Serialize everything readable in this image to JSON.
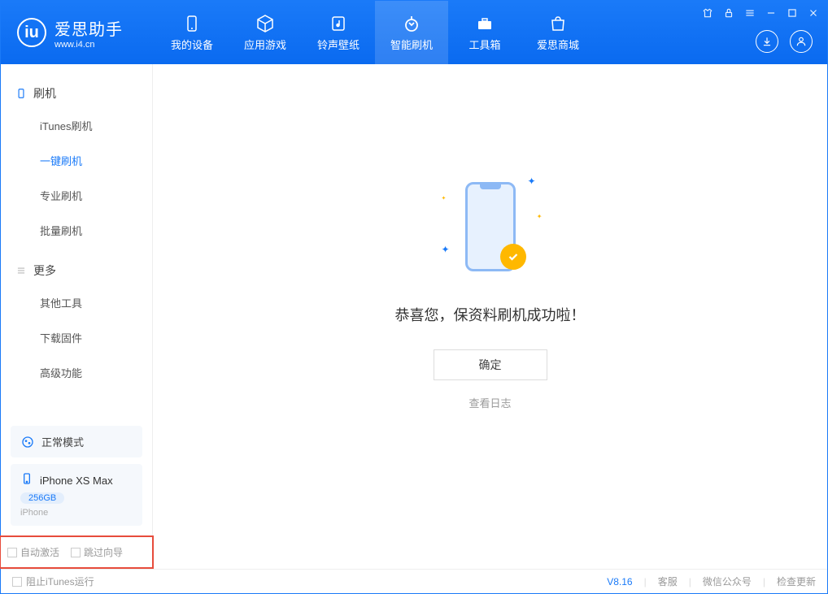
{
  "header": {
    "logo_title": "爱思助手",
    "logo_url": "www.i4.cn",
    "tabs": [
      {
        "label": "我的设备"
      },
      {
        "label": "应用游戏"
      },
      {
        "label": "铃声壁纸"
      },
      {
        "label": "智能刷机"
      },
      {
        "label": "工具箱"
      },
      {
        "label": "爱思商城"
      }
    ]
  },
  "sidebar": {
    "group1_title": "刷机",
    "group1_items": [
      {
        "label": "iTunes刷机"
      },
      {
        "label": "一键刷机"
      },
      {
        "label": "专业刷机"
      },
      {
        "label": "批量刷机"
      }
    ],
    "group2_title": "更多",
    "group2_items": [
      {
        "label": "其他工具"
      },
      {
        "label": "下载固件"
      },
      {
        "label": "高级功能"
      }
    ],
    "mode_label": "正常模式",
    "device_name": "iPhone XS Max",
    "device_storage": "256GB",
    "device_type": "iPhone",
    "checkbox1": "自动激活",
    "checkbox2": "跳过向导"
  },
  "main": {
    "success_text": "恭喜您，保资料刷机成功啦！",
    "confirm_label": "确定",
    "log_link": "查看日志"
  },
  "footer": {
    "block_itunes": "阻止iTunes运行",
    "version": "V8.16",
    "link1": "客服",
    "link2": "微信公众号",
    "link3": "检查更新"
  }
}
